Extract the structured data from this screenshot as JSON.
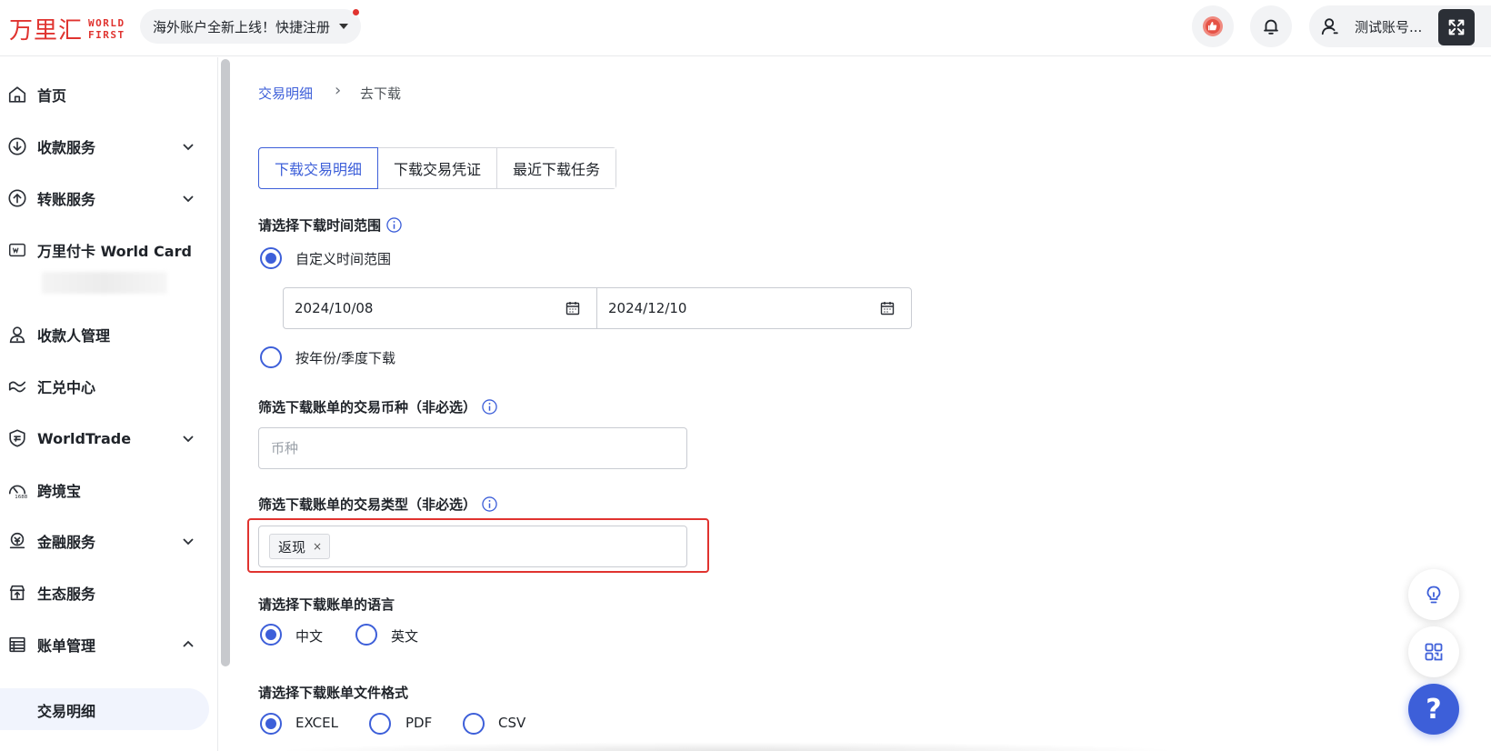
{
  "header": {
    "logo_cn": "万里汇",
    "logo_en_line1": "WORLD",
    "logo_en_line2": "FIRST",
    "promo_text": "海外账户全新上线！快捷注册",
    "user_name": "测试账号..."
  },
  "colors": {
    "accent": "#3d5fd9",
    "brand_red": "#e0332f",
    "highlight_box": "#e0332f"
  },
  "sidebar": {
    "items": [
      {
        "label": "首页",
        "icon": "home-icon"
      },
      {
        "label": "收款服务",
        "icon": "receive-icon",
        "expandable": true
      },
      {
        "label": "转账服务",
        "icon": "transfer-icon",
        "expandable": true
      },
      {
        "label": "万里付卡 World Card",
        "icon": "card-icon"
      },
      {
        "label": "收款人管理",
        "icon": "payee-icon"
      },
      {
        "label": "汇兑中心",
        "icon": "exchange-icon"
      },
      {
        "label": "WorldTrade",
        "icon": "shield-icon",
        "expandable": true
      },
      {
        "label": "跨境宝",
        "icon": "speedometer-icon"
      },
      {
        "label": "金融服务",
        "icon": "finance-icon",
        "expandable": true
      },
      {
        "label": "生态服务",
        "icon": "ecosystem-icon"
      },
      {
        "label": "账单管理",
        "icon": "bill-icon",
        "expanded": true
      },
      {
        "label": "交易明细",
        "selected": true
      }
    ]
  },
  "breadcrumb": {
    "parent": "交易明细",
    "separator": "›",
    "current": "去下载"
  },
  "tabs": [
    {
      "label": "下载交易明细",
      "active": true
    },
    {
      "label": "下载交易凭证"
    },
    {
      "label": "最近下载任务"
    }
  ],
  "time_range": {
    "title": "请选择下载时间范围",
    "option_custom": "自定义时间范围",
    "start_date": "2024/10/08",
    "end_date": "2024/12/10",
    "option_period": "按年份/季度下载"
  },
  "currency_filter": {
    "title": "筛选下载账单的交易币种（非必选）",
    "placeholder": "币种"
  },
  "type_filter": {
    "title": "筛选下载账单的交易类型（非必选）",
    "tag": "返现",
    "tag_close": "×"
  },
  "language": {
    "title": "请选择下载账单的语言",
    "options": [
      "中文",
      "英文"
    ],
    "selected": "中文"
  },
  "format": {
    "title": "请选择下载账单文件格式",
    "options": [
      "EXCEL",
      "PDF",
      "CSV"
    ],
    "selected": "EXCEL"
  },
  "floating": {
    "help_label": "?"
  }
}
